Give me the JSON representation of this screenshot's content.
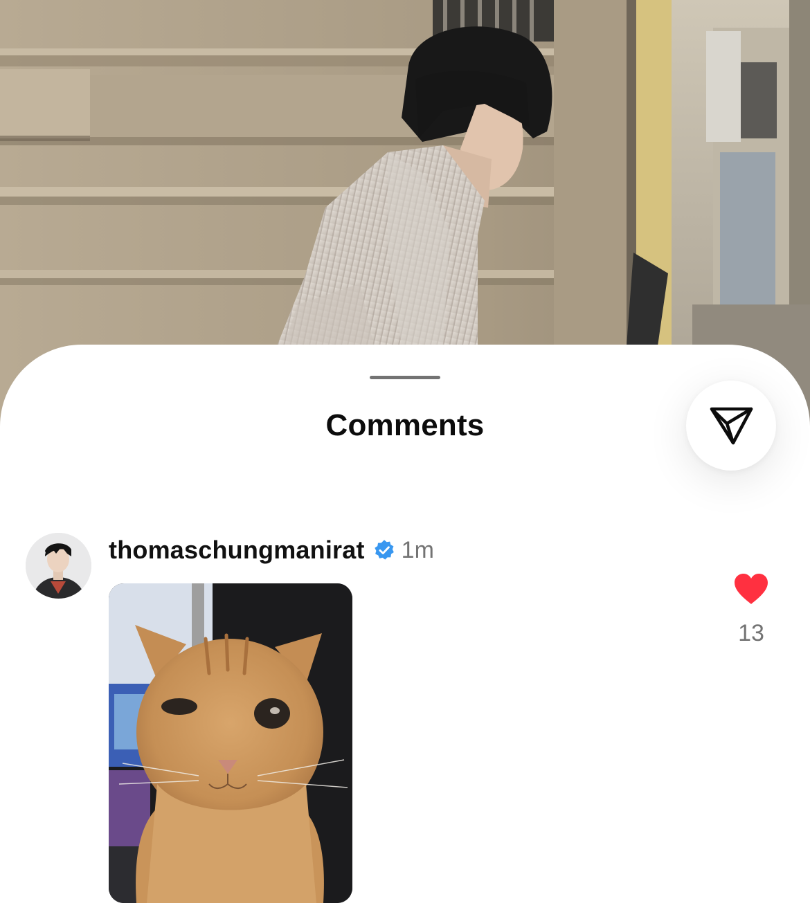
{
  "post": {
    "photo": "post-photo-man-in-striped-shirt-by-stone-wall"
  },
  "sheet": {
    "title": "Comments",
    "share_icon": "paper-plane-icon"
  },
  "comment": {
    "username": "thomaschungmanirat",
    "verified": true,
    "verified_icon": "verified-badge-icon",
    "timestamp": "1m",
    "media": "cat-photo",
    "liked": true,
    "like_icon": "heart-icon",
    "like_count": "13"
  },
  "colors": {
    "title": "#0c0c0c",
    "secondary_text": "#737373",
    "verified_blue": "#3897f0",
    "like_red": "#ff3040",
    "handle": "#737373"
  }
}
